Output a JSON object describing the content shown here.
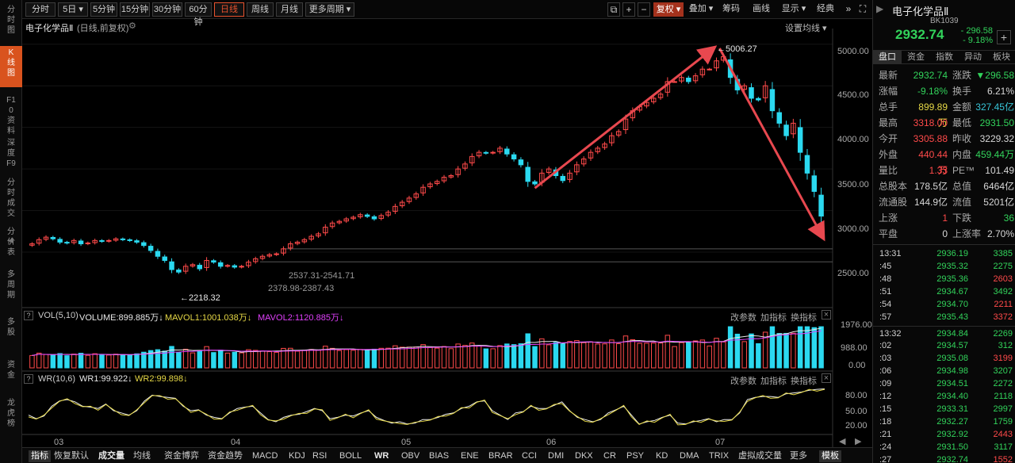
{
  "sidebar": {
    "items": [
      "分时图",
      "K线图",
      "F10资料",
      "深度F9",
      "分时成交",
      "分价表",
      "多周期",
      "多股",
      "资金",
      "龙虎榜"
    ],
    "active": 1
  },
  "toolbar": {
    "periods": [
      "分时",
      "5日",
      "5分钟",
      "15分钟",
      "30分钟",
      "60分钟",
      "日线",
      "周线",
      "月线",
      "更多周期"
    ],
    "active": "日线",
    "icons": [
      "window-icon",
      "plus-icon",
      "minus-icon"
    ],
    "adjust": "复权",
    "right_buttons": [
      "叠加",
      "筹码",
      "画线",
      "显示",
      "经典"
    ],
    "window_controls": [
      "fast-forward-icon",
      "fullscreen-icon"
    ]
  },
  "chart": {
    "title": "电子化学品Ⅱ",
    "subtitle": "(日线,前复权)",
    "settings_label": "设置均线",
    "y_axis_labels": [
      "5000.00",
      "4500.00",
      "4000.00",
      "3500.00",
      "3000.00",
      "2500.00"
    ],
    "x_axis_labels": [
      "03",
      "04",
      "05",
      "06",
      "07"
    ],
    "annotations": {
      "high": "5006.27",
      "low": "2218.32",
      "gap1": "2537.31-2541.71",
      "gap2": "2378.98-2387.43"
    }
  },
  "volume_panel": {
    "title": "VOL(5,10)",
    "volume": "VOLUME:899.885万",
    "mavol1": "MAVOL1:1001.038万",
    "mavol2": "MAVOL2:1120.885万",
    "y_labels": [
      "1976.00",
      "988.00",
      "0.00"
    ],
    "actions": [
      "改参数",
      "加指标",
      "换指标"
    ]
  },
  "wr_panel": {
    "title": "WR(10,6)",
    "wr1": "WR1:99.922",
    "wr2": "WR2:99.898",
    "y_labels": [
      "80.00",
      "50.00",
      "20.00"
    ],
    "actions": [
      "改参数",
      "加指标",
      "换指标"
    ]
  },
  "bottom_bar": {
    "items": [
      "指标",
      "恢复默认",
      "成交量",
      "均线",
      "资金博弈",
      "资金趋势",
      "MACD",
      "KDJ",
      "RSI",
      "BOLL",
      "WR",
      "OBV",
      "BIAS",
      "ENE",
      "BRAR",
      "CCI",
      "DMI",
      "DKX",
      "CR",
      "PSY",
      "KD",
      "DMA",
      "TRIX",
      "虚拟成交量",
      "更多",
      "模板"
    ]
  },
  "quote": {
    "name": "电子化学品Ⅱ",
    "code": "BK1039",
    "price": "2932.74",
    "change": "- 296.58",
    "change_pct": "- 9.18%",
    "tabs": [
      "盘口",
      "资金",
      "指数",
      "异动",
      "板块"
    ],
    "stats": [
      {
        "l1": "最新",
        "v1": "2932.74",
        "l2": "涨跌",
        "v2": "▼296.58",
        "c1": "g",
        "c2": "g"
      },
      {
        "l1": "涨幅",
        "v1": "-9.18%",
        "l2": "换手",
        "v2": "6.21%",
        "c1": "g",
        "c2": "w"
      },
      {
        "l1": "总手",
        "v1": "899.89万",
        "l2": "金额",
        "v2": "327.45亿",
        "c1": "y",
        "c2": "c"
      },
      {
        "l1": "最高",
        "v1": "3318.00",
        "l2": "最低",
        "v2": "2931.50",
        "c1": "r",
        "c2": "g"
      },
      {
        "l1": "今开",
        "v1": "3305.88",
        "l2": "昨收",
        "v2": "3229.32",
        "c1": "r",
        "c2": "w"
      },
      {
        "l1": "外盘",
        "v1": "440.44万",
        "l2": "内盘",
        "v2": "459.44万",
        "c1": "r",
        "c2": "g"
      },
      {
        "l1": "量比",
        "v1": "1.33",
        "l2": "PE™",
        "v2": "101.49",
        "c1": "r",
        "c2": "w"
      },
      {
        "l1": "总股本",
        "v1": "178.5亿",
        "l2": "总值",
        "v2": "6464亿",
        "c1": "w",
        "c2": "w"
      },
      {
        "l1": "流通股",
        "v1": "144.9亿",
        "l2": "流值",
        "v2": "5201亿",
        "c1": "w",
        "c2": "w"
      },
      {
        "l1": "上涨",
        "v1": "1",
        "l2": "下跌",
        "v2": "36",
        "c1": "r",
        "c2": "g"
      },
      {
        "l1": "平盘",
        "v1": "0",
        "l2": "上涨率",
        "v2": "2.70%",
        "c1": "w",
        "c2": "w"
      }
    ]
  },
  "ticks": [
    {
      "t": "13:31",
      "p": "2936.19",
      "v": "3385",
      "c": "g"
    },
    {
      "t": ":45",
      "p": "2935.32",
      "v": "2275",
      "c": "g"
    },
    {
      "t": ":48",
      "p": "2935.36",
      "v": "2603",
      "c": "r"
    },
    {
      "t": ":51",
      "p": "2934.67",
      "v": "3492",
      "c": "g"
    },
    {
      "t": ":54",
      "p": "2934.70",
      "v": "2211",
      "c": "r"
    },
    {
      "t": ":57",
      "p": "2935.43",
      "v": "3372",
      "c": "r"
    },
    {
      "t": "13:32",
      "p": "2934.84",
      "v": "2269",
      "c": "g"
    },
    {
      "t": ":02",
      "p": "2934.57",
      "v": "312",
      "c": "g"
    },
    {
      "t": ":03",
      "p": "2935.08",
      "v": "3199",
      "c": "r"
    },
    {
      "t": ":06",
      "p": "2934.98",
      "v": "3207",
      "c": "g"
    },
    {
      "t": ":09",
      "p": "2934.51",
      "v": "2272",
      "c": "g"
    },
    {
      "t": ":12",
      "p": "2934.40",
      "v": "2118",
      "c": "g"
    },
    {
      "t": ":15",
      "p": "2933.31",
      "v": "2997",
      "c": "g"
    },
    {
      "t": ":18",
      "p": "2932.27",
      "v": "1759",
      "c": "g"
    },
    {
      "t": ":21",
      "p": "2932.92",
      "v": "2443",
      "c": "r"
    },
    {
      "t": ":24",
      "p": "2931.50",
      "v": "3117",
      "c": "g"
    },
    {
      "t": ":27",
      "p": "2932.74",
      "v": "1552",
      "c": "r"
    }
  ],
  "colors": {
    "up": "#ff4a4a",
    "down": "#2bd9f0",
    "ma1": "#e8e8e8",
    "ma2": "#e040fb",
    "wr1": "#f0f0f0",
    "wr2": "#e6d846",
    "arrow": "#e8484f"
  },
  "chart_data": {
    "type": "candlestick",
    "closes": [
      2600,
      2650,
      2680,
      2660,
      2620,
      2610,
      2640,
      2600,
      2610,
      2640,
      2630,
      2640,
      2660,
      2650,
      2640,
      2620,
      2580,
      2520,
      2450,
      2400,
      2290,
      2260,
      2330,
      2350,
      2300,
      2400,
      2380,
      2330,
      2340,
      2320,
      2330,
      2380,
      2420,
      2450,
      2470,
      2480,
      2540,
      2600,
      2620,
      2650,
      2690,
      2720,
      2800,
      2850,
      2870,
      2900,
      2920,
      2950,
      2930,
      2900,
      2940,
      2980,
      3050,
      3100,
      3150,
      3200,
      3280,
      3320,
      3350,
      3400,
      3420,
      3500,
      3560,
      3650,
      3700,
      3690,
      3700,
      3750,
      3680,
      3620,
      3550,
      3350,
      3320,
      3450,
      3500,
      3420,
      3360,
      3450,
      3550,
      3620,
      3700,
      3750,
      3800,
      3900,
      3950,
      4100,
      4200,
      4250,
      4300,
      4350,
      4400,
      4550,
      4550,
      4600,
      4550,
      4620,
      4700,
      4700,
      4800,
      4850,
      4600,
      4450,
      4500,
      4350,
      4330,
      4500,
      4200,
      4050,
      3900,
      4050,
      3700,
      3450,
      3230,
      2933
    ],
    "ylim": [
      2100,
      5150
    ],
    "high": "5006.27",
    "low": "2218.32",
    "volume_ylim": [
      0,
      1976
    ],
    "wr": [
      40,
      32,
      38,
      60,
      72,
      75,
      70,
      60,
      58,
      55,
      65,
      50,
      45,
      40,
      50,
      72,
      85,
      82,
      80,
      78,
      60,
      50,
      52,
      40,
      35,
      32,
      45,
      55,
      58,
      60,
      45,
      30,
      25,
      35,
      40,
      42,
      48,
      55,
      50,
      32,
      35,
      40,
      38,
      45,
      50,
      35,
      28,
      22,
      25,
      20,
      22,
      30,
      30,
      35,
      42,
      45,
      55,
      60,
      70,
      72,
      50,
      40,
      30,
      45,
      48,
      60,
      55,
      55,
      62,
      70,
      50,
      35,
      30,
      25,
      30,
      45,
      52,
      60,
      40,
      20,
      25,
      28,
      35,
      40,
      22,
      20,
      25,
      28,
      32,
      25,
      30,
      30,
      45,
      75,
      80,
      82,
      82,
      80,
      88,
      90,
      92,
      96,
      98,
      99
    ]
  }
}
